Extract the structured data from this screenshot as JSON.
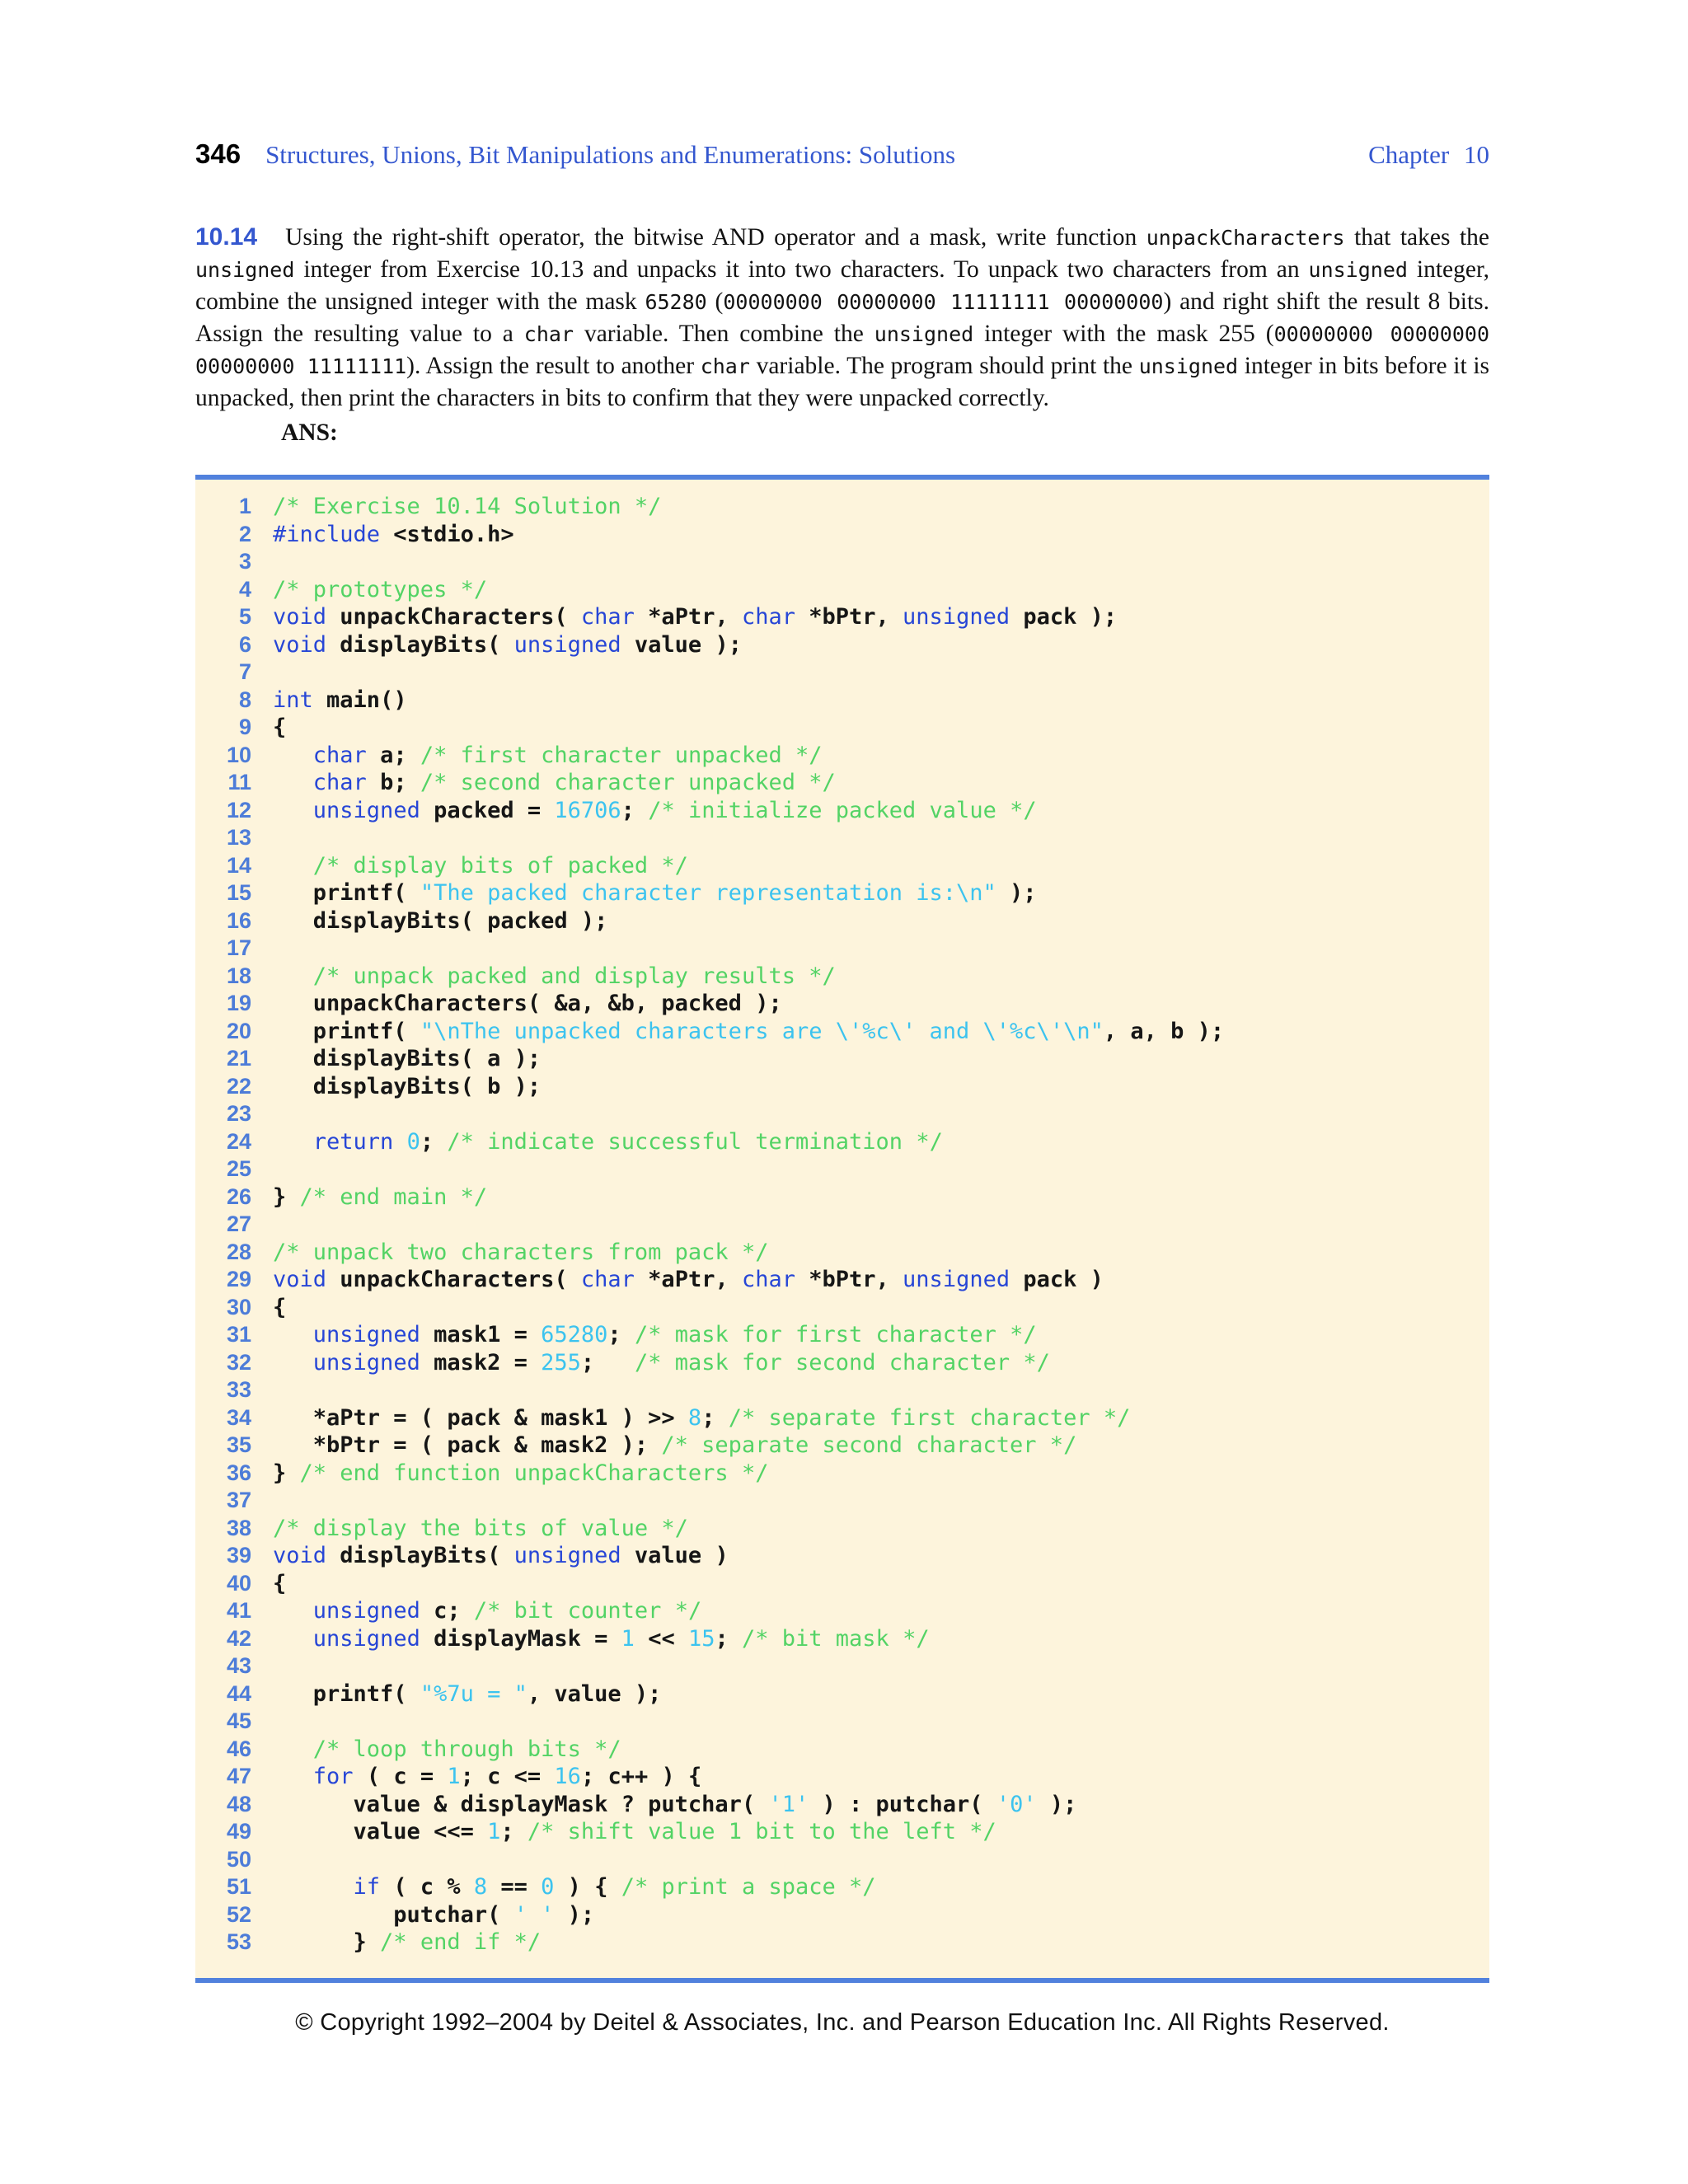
{
  "colors": {
    "page_background": "#ffffff",
    "text_black": "#121212",
    "accent_blue": "#3457cf",
    "keyword_blue": "#2746d6",
    "line_number_blue": "#4d7cd8",
    "comment_green": "#53d365",
    "literal_cyan": "#3cc3ef",
    "code_text": "#161616",
    "rule_blue": "#5181dd",
    "code_background": "#fdf4dc"
  },
  "header": {
    "page_number": "346",
    "title": "Structures, Unions, Bit Manipulations and Enumerations: Solutions",
    "chapter": "Chapter 10"
  },
  "exercise": {
    "number": "10.14",
    "ans_label": "ANS:",
    "body_segments": [
      {
        "f": "serif",
        "t": "Using the right-shift operator, the bitwise AND operator and a mask, write function "
      },
      {
        "f": "mono",
        "t": "unpackCharacters"
      },
      {
        "f": "serif",
        "t": " that takes the "
      },
      {
        "f": "mono",
        "t": "unsigned"
      },
      {
        "f": "serif",
        "t": " integer from Exercise 10.13 and unpacks it into two characters. To unpack two characters from an "
      },
      {
        "f": "mono",
        "t": "unsigned"
      },
      {
        "f": "serif",
        "t": " integer, combine the unsigned integer with the mask "
      },
      {
        "f": "mono",
        "t": "65280"
      },
      {
        "f": "serif",
        "t": " ("
      },
      {
        "f": "mono",
        "t": "00000000 00000000 11111111 00000000"
      },
      {
        "f": "serif",
        "t": ") and right shift the result 8 bits. Assign the resulting value to a "
      },
      {
        "f": "mono",
        "t": "char"
      },
      {
        "f": "serif",
        "t": " variable. Then combine the "
      },
      {
        "f": "mono",
        "t": "unsigned"
      },
      {
        "f": "serif",
        "t": " integer with the mask 255 ("
      },
      {
        "f": "mono",
        "t": "00000000 00000000 00000000 11111111"
      },
      {
        "f": "serif",
        "t": "). Assign the result to another "
      },
      {
        "f": "mono",
        "t": "char"
      },
      {
        "f": "serif",
        "t": " variable. The program should print the "
      },
      {
        "f": "mono",
        "t": "unsigned"
      },
      {
        "f": "serif",
        "t": " integer in bits before it is unpacked, then print the characters in bits to confirm that they were unpacked correctly."
      }
    ]
  },
  "code": {
    "lines": [
      {
        "n": "1",
        "segs": [
          {
            "c": "cm",
            "t": "/* Exercise 10.14 Solution */"
          }
        ]
      },
      {
        "n": "2",
        "segs": [
          {
            "c": "kw",
            "t": "#include"
          },
          {
            "c": "pl",
            "t": " <stdio.h>"
          }
        ]
      },
      {
        "n": "3",
        "segs": []
      },
      {
        "n": "4",
        "segs": [
          {
            "c": "cm",
            "t": "/* prototypes */"
          }
        ]
      },
      {
        "n": "5",
        "segs": [
          {
            "c": "kw",
            "t": "void"
          },
          {
            "c": "pl",
            "t": " unpackCharacters( "
          },
          {
            "c": "kw",
            "t": "char"
          },
          {
            "c": "pl",
            "t": " *aPtr, "
          },
          {
            "c": "kw",
            "t": "char"
          },
          {
            "c": "pl",
            "t": " *bPtr, "
          },
          {
            "c": "kw",
            "t": "unsigned"
          },
          {
            "c": "pl",
            "t": " pack );"
          }
        ]
      },
      {
        "n": "6",
        "segs": [
          {
            "c": "kw",
            "t": "void"
          },
          {
            "c": "pl",
            "t": " displayBits( "
          },
          {
            "c": "kw",
            "t": "unsigned"
          },
          {
            "c": "pl",
            "t": " value );"
          }
        ]
      },
      {
        "n": "7",
        "segs": []
      },
      {
        "n": "8",
        "segs": [
          {
            "c": "kw",
            "t": "int"
          },
          {
            "c": "pl",
            "t": " main()"
          }
        ]
      },
      {
        "n": "9",
        "segs": [
          {
            "c": "pl",
            "t": "{"
          }
        ]
      },
      {
        "n": "10",
        "segs": [
          {
            "c": "pl",
            "t": "   "
          },
          {
            "c": "kw",
            "t": "char"
          },
          {
            "c": "pl",
            "t": " a; "
          },
          {
            "c": "cm",
            "t": "/* first character unpacked */"
          }
        ]
      },
      {
        "n": "11",
        "segs": [
          {
            "c": "pl",
            "t": "   "
          },
          {
            "c": "kw",
            "t": "char"
          },
          {
            "c": "pl",
            "t": " b; "
          },
          {
            "c": "cm",
            "t": "/* second character unpacked */"
          }
        ]
      },
      {
        "n": "12",
        "segs": [
          {
            "c": "pl",
            "t": "   "
          },
          {
            "c": "kw",
            "t": "unsigned"
          },
          {
            "c": "pl",
            "t": " packed = "
          },
          {
            "c": "li",
            "t": "16706"
          },
          {
            "c": "pl",
            "t": "; "
          },
          {
            "c": "cm",
            "t": "/* initialize packed value */"
          }
        ]
      },
      {
        "n": "13",
        "segs": []
      },
      {
        "n": "14",
        "segs": [
          {
            "c": "pl",
            "t": "   "
          },
          {
            "c": "cm",
            "t": "/* display bits of packed */"
          }
        ]
      },
      {
        "n": "15",
        "segs": [
          {
            "c": "pl",
            "t": "   printf( "
          },
          {
            "c": "st",
            "t": "\"The packed character representation is:\\n\""
          },
          {
            "c": "pl",
            "t": " );"
          }
        ]
      },
      {
        "n": "16",
        "segs": [
          {
            "c": "pl",
            "t": "   displayBits( packed );"
          }
        ]
      },
      {
        "n": "17",
        "segs": []
      },
      {
        "n": "18",
        "segs": [
          {
            "c": "pl",
            "t": "   "
          },
          {
            "c": "cm",
            "t": "/* unpack packed and display results */"
          }
        ]
      },
      {
        "n": "19",
        "segs": [
          {
            "c": "pl",
            "t": "   unpackCharacters( &a, &b, packed );"
          }
        ]
      },
      {
        "n": "20",
        "segs": [
          {
            "c": "pl",
            "t": "   printf( "
          },
          {
            "c": "st",
            "t": "\"\\nThe unpacked characters are \\'%c\\' and \\'%c\\'\\n\""
          },
          {
            "c": "pl",
            "t": ", a, b );"
          }
        ]
      },
      {
        "n": "21",
        "segs": [
          {
            "c": "pl",
            "t": "   displayBits( a );"
          }
        ]
      },
      {
        "n": "22",
        "segs": [
          {
            "c": "pl",
            "t": "   displayBits( b );"
          }
        ]
      },
      {
        "n": "23",
        "segs": []
      },
      {
        "n": "24",
        "segs": [
          {
            "c": "pl",
            "t": "   "
          },
          {
            "c": "kw",
            "t": "return"
          },
          {
            "c": "pl",
            "t": " "
          },
          {
            "c": "li",
            "t": "0"
          },
          {
            "c": "pl",
            "t": "; "
          },
          {
            "c": "cm",
            "t": "/* indicate successful termination */"
          }
        ]
      },
      {
        "n": "25",
        "segs": []
      },
      {
        "n": "26",
        "segs": [
          {
            "c": "pl",
            "t": "} "
          },
          {
            "c": "cm",
            "t": "/* end main */"
          }
        ]
      },
      {
        "n": "27",
        "segs": []
      },
      {
        "n": "28",
        "segs": [
          {
            "c": "cm",
            "t": "/* unpack two characters from pack */"
          }
        ]
      },
      {
        "n": "29",
        "segs": [
          {
            "c": "kw",
            "t": "void"
          },
          {
            "c": "pl",
            "t": " unpackCharacters( "
          },
          {
            "c": "kw",
            "t": "char"
          },
          {
            "c": "pl",
            "t": " *aPtr, "
          },
          {
            "c": "kw",
            "t": "char"
          },
          {
            "c": "pl",
            "t": " *bPtr, "
          },
          {
            "c": "kw",
            "t": "unsigned"
          },
          {
            "c": "pl",
            "t": " pack )"
          }
        ]
      },
      {
        "n": "30",
        "segs": [
          {
            "c": "pl",
            "t": "{"
          }
        ]
      },
      {
        "n": "31",
        "segs": [
          {
            "c": "pl",
            "t": "   "
          },
          {
            "c": "kw",
            "t": "unsigned"
          },
          {
            "c": "pl",
            "t": " mask1 = "
          },
          {
            "c": "li",
            "t": "65280"
          },
          {
            "c": "pl",
            "t": "; "
          },
          {
            "c": "cm",
            "t": "/* mask for first character */"
          }
        ]
      },
      {
        "n": "32",
        "segs": [
          {
            "c": "pl",
            "t": "   "
          },
          {
            "c": "kw",
            "t": "unsigned"
          },
          {
            "c": "pl",
            "t": " mask2 = "
          },
          {
            "c": "li",
            "t": "255"
          },
          {
            "c": "pl",
            "t": ";   "
          },
          {
            "c": "cm",
            "t": "/* mask for second character */"
          }
        ]
      },
      {
        "n": "33",
        "segs": []
      },
      {
        "n": "34",
        "segs": [
          {
            "c": "pl",
            "t": "   *aPtr = ( pack & mask1 ) >> "
          },
          {
            "c": "li",
            "t": "8"
          },
          {
            "c": "pl",
            "t": "; "
          },
          {
            "c": "cm",
            "t": "/* separate first character */"
          }
        ]
      },
      {
        "n": "35",
        "segs": [
          {
            "c": "pl",
            "t": "   *bPtr = ( pack & mask2 ); "
          },
          {
            "c": "cm",
            "t": "/* separate second character */"
          }
        ]
      },
      {
        "n": "36",
        "segs": [
          {
            "c": "pl",
            "t": "} "
          },
          {
            "c": "cm",
            "t": "/* end function unpackCharacters */"
          }
        ]
      },
      {
        "n": "37",
        "segs": []
      },
      {
        "n": "38",
        "segs": [
          {
            "c": "cm",
            "t": "/* display the bits of value */"
          }
        ]
      },
      {
        "n": "39",
        "segs": [
          {
            "c": "kw",
            "t": "void"
          },
          {
            "c": "pl",
            "t": " displayBits( "
          },
          {
            "c": "kw",
            "t": "unsigned"
          },
          {
            "c": "pl",
            "t": " value )"
          }
        ]
      },
      {
        "n": "40",
        "segs": [
          {
            "c": "pl",
            "t": "{"
          }
        ]
      },
      {
        "n": "41",
        "segs": [
          {
            "c": "pl",
            "t": "   "
          },
          {
            "c": "kw",
            "t": "unsigned"
          },
          {
            "c": "pl",
            "t": " c; "
          },
          {
            "c": "cm",
            "t": "/* bit counter */"
          }
        ]
      },
      {
        "n": "42",
        "segs": [
          {
            "c": "pl",
            "t": "   "
          },
          {
            "c": "kw",
            "t": "unsigned"
          },
          {
            "c": "pl",
            "t": " displayMask = "
          },
          {
            "c": "li",
            "t": "1"
          },
          {
            "c": "pl",
            "t": " << "
          },
          {
            "c": "li",
            "t": "15"
          },
          {
            "c": "pl",
            "t": "; "
          },
          {
            "c": "cm",
            "t": "/* bit mask */"
          }
        ]
      },
      {
        "n": "43",
        "segs": []
      },
      {
        "n": "44",
        "segs": [
          {
            "c": "pl",
            "t": "   printf( "
          },
          {
            "c": "st",
            "t": "\"%7u = \""
          },
          {
            "c": "pl",
            "t": ", value );"
          }
        ]
      },
      {
        "n": "45",
        "segs": []
      },
      {
        "n": "46",
        "segs": [
          {
            "c": "pl",
            "t": "   "
          },
          {
            "c": "cm",
            "t": "/* loop through bits */"
          }
        ]
      },
      {
        "n": "47",
        "segs": [
          {
            "c": "pl",
            "t": "   "
          },
          {
            "c": "kw",
            "t": "for"
          },
          {
            "c": "pl",
            "t": " ( c = "
          },
          {
            "c": "li",
            "t": "1"
          },
          {
            "c": "pl",
            "t": "; c <= "
          },
          {
            "c": "li",
            "t": "16"
          },
          {
            "c": "pl",
            "t": "; c++ ) {"
          }
        ]
      },
      {
        "n": "48",
        "segs": [
          {
            "c": "pl",
            "t": "      value & displayMask ? putchar( "
          },
          {
            "c": "st",
            "t": "'1'"
          },
          {
            "c": "pl",
            "t": " ) : putchar( "
          },
          {
            "c": "st",
            "t": "'0'"
          },
          {
            "c": "pl",
            "t": " );"
          }
        ]
      },
      {
        "n": "49",
        "segs": [
          {
            "c": "pl",
            "t": "      value <<= "
          },
          {
            "c": "li",
            "t": "1"
          },
          {
            "c": "pl",
            "t": "; "
          },
          {
            "c": "cm",
            "t": "/* shift value 1 bit to the left */"
          }
        ]
      },
      {
        "n": "50",
        "segs": []
      },
      {
        "n": "51",
        "segs": [
          {
            "c": "pl",
            "t": "      "
          },
          {
            "c": "kw",
            "t": "if"
          },
          {
            "c": "pl",
            "t": " ( c % "
          },
          {
            "c": "li",
            "t": "8"
          },
          {
            "c": "pl",
            "t": " == "
          },
          {
            "c": "li",
            "t": "0"
          },
          {
            "c": "pl",
            "t": " ) { "
          },
          {
            "c": "cm",
            "t": "/* print a space */"
          }
        ]
      },
      {
        "n": "52",
        "segs": [
          {
            "c": "pl",
            "t": "         putchar( "
          },
          {
            "c": "st",
            "t": "' '"
          },
          {
            "c": "pl",
            "t": " );"
          }
        ]
      },
      {
        "n": "53",
        "segs": [
          {
            "c": "pl",
            "t": "      } "
          },
          {
            "c": "cm",
            "t": "/* end if */"
          }
        ]
      }
    ]
  },
  "footer": {
    "copyright": "© Copyright 1992–2004 by Deitel & Associates, Inc. and Pearson Education Inc. All Rights Reserved."
  }
}
